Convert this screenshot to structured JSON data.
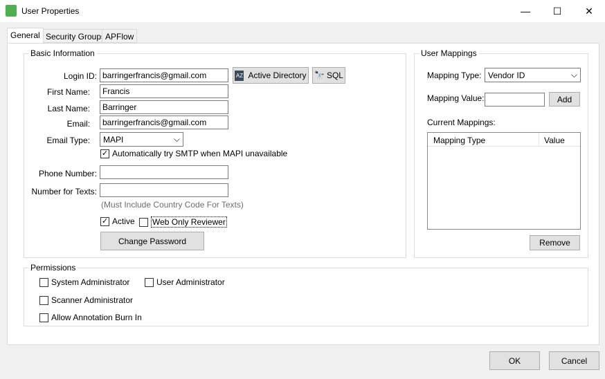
{
  "window": {
    "title": "User Properties",
    "minimize": "—",
    "maximize": "☐",
    "close": "✕"
  },
  "tabs": [
    {
      "label": "General"
    },
    {
      "label": "Security Groups"
    },
    {
      "label": "APFlow"
    }
  ],
  "basic": {
    "legend": "Basic Information",
    "login_label": "Login ID:",
    "login_value": "barringerfrancis@gmail.com",
    "ad_button": "Active Directory",
    "sql_button": "SQL",
    "first_label": "First Name:",
    "first_value": "Francis",
    "last_label": "Last Name:",
    "last_value": "Barringer",
    "email_label": "Email:",
    "email_value": "barringerfrancis@gmail.com",
    "email_type_label": "Email Type:",
    "email_type_value": "MAPI",
    "smtp_label": "Automatically try SMTP when MAPI unavailable",
    "smtp_checked": true,
    "phone_label": "Phone Number:",
    "phone_value": "",
    "texts_label": "Number for Texts:",
    "texts_value": "",
    "texts_hint": "(Must Include Country Code For Texts)",
    "active_label": "Active",
    "active_checked": true,
    "web_label": "Web Only Reviewer",
    "web_checked": false,
    "change_password": "Change Password"
  },
  "mappings": {
    "legend": "User Mappings",
    "type_label": "Mapping Type:",
    "type_value": "Vendor ID",
    "value_label": "Mapping Value:",
    "value_value": "",
    "add": "Add",
    "current_label": "Current Mappings:",
    "columns": [
      "Mapping Type",
      "Value"
    ],
    "rows": [],
    "remove": "Remove"
  },
  "permissions": {
    "legend": "Permissions",
    "items": [
      {
        "label": "System Administrator",
        "checked": false
      },
      {
        "label": "User Administrator",
        "checked": false
      },
      {
        "label": "Scanner Administrator",
        "checked": false
      },
      {
        "label": "Allow Annotation Burn In",
        "checked": false
      }
    ]
  },
  "footer": {
    "ok": "OK",
    "cancel": "Cancel"
  }
}
